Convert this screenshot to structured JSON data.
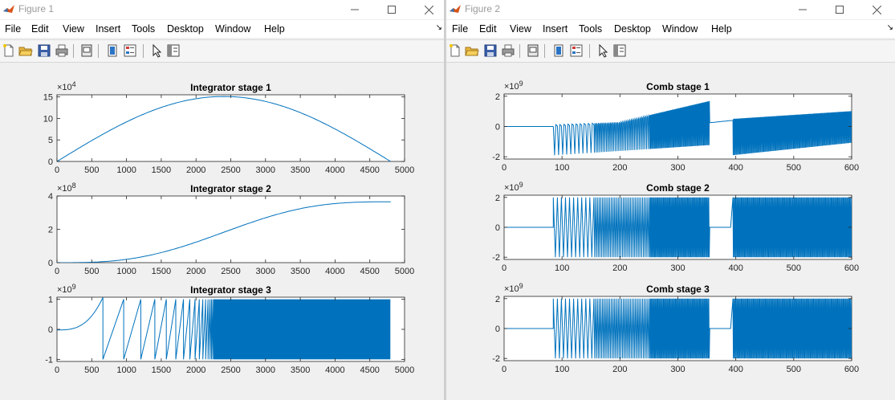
{
  "windows": [
    {
      "title": "Figure 1",
      "menu": [
        "File",
        "Edit",
        "View",
        "Insert",
        "Tools",
        "Desktop",
        "Window",
        "Help"
      ],
      "axes": [
        {
          "title": "Integrator stage 1",
          "xticks": [
            "0",
            "500",
            "1000",
            "1500",
            "2000",
            "2500",
            "3000",
            "3500",
            "4000",
            "4500",
            "5000"
          ],
          "yticks": [
            "0",
            "5",
            "10",
            "15"
          ],
          "exponent": "4",
          "xlim": [
            0,
            5000
          ],
          "ylim": [
            0,
            15.5
          ],
          "signal": "halfsine",
          "amp": 15.1,
          "x_end": 4800
        },
        {
          "title": "Integrator stage 2",
          "xticks": [
            "0",
            "500",
            "1000",
            "1500",
            "2000",
            "2500",
            "3000",
            "3500",
            "4000",
            "4500",
            "5000"
          ],
          "yticks": [
            "0",
            "2",
            "4"
          ],
          "exponent": "8",
          "xlim": [
            0,
            5000
          ],
          "ylim": [
            0,
            4
          ],
          "signal": "scurve",
          "amp": 3.65,
          "x_end": 4800
        },
        {
          "title": "Integrator stage 3",
          "xticks": [
            "0",
            "500",
            "1000",
            "1500",
            "2000",
            "2500",
            "3000",
            "3500",
            "4000",
            "4500",
            "5000"
          ],
          "yticks": [
            "-1",
            "0",
            "1"
          ],
          "exponent": "9",
          "xlim": [
            0,
            5000
          ],
          "ylim": [
            -1.07,
            1.07
          ],
          "signal": "wrap",
          "x_end": 4800
        }
      ]
    },
    {
      "title": "Figure 2",
      "menu": [
        "File",
        "Edit",
        "View",
        "Insert",
        "Tools",
        "Desktop",
        "Window",
        "Help"
      ],
      "axes": [
        {
          "title": "Comb stage 1",
          "xticks": [
            "0",
            "100",
            "200",
            "300",
            "400",
            "500",
            "600"
          ],
          "yticks": [
            "-2",
            "0",
            "2"
          ],
          "exponent": "9",
          "xlim": [
            0,
            600
          ],
          "ylim": [
            -2.15,
            2.15
          ],
          "signal": "comb1",
          "x_end": 600
        },
        {
          "title": "Comb stage 2",
          "xticks": [
            "0",
            "100",
            "200",
            "300",
            "400",
            "500",
            "600"
          ],
          "yticks": [
            "-2",
            "0",
            "2"
          ],
          "exponent": "9",
          "xlim": [
            0,
            600
          ],
          "ylim": [
            -2.15,
            2.15
          ],
          "signal": "comb2",
          "x_end": 600
        },
        {
          "title": "Comb stage 3",
          "xticks": [
            "0",
            "100",
            "200",
            "300",
            "400",
            "500",
            "600"
          ],
          "yticks": [
            "-2",
            "0",
            "2"
          ],
          "exponent": "9",
          "xlim": [
            0,
            600
          ],
          "ylim": [
            -2.15,
            2.15
          ],
          "signal": "comb3",
          "x_end": 600
        }
      ]
    }
  ],
  "colors": {
    "line": "#0072bd",
    "axis": "#262626"
  },
  "icons": [
    "new-file-icon",
    "open-folder-icon",
    "save-icon",
    "print-icon",
    "print-preview-icon",
    "link-plot-icon",
    "insert-legend-icon",
    "pointer-icon",
    "property-inspector-icon"
  ]
}
